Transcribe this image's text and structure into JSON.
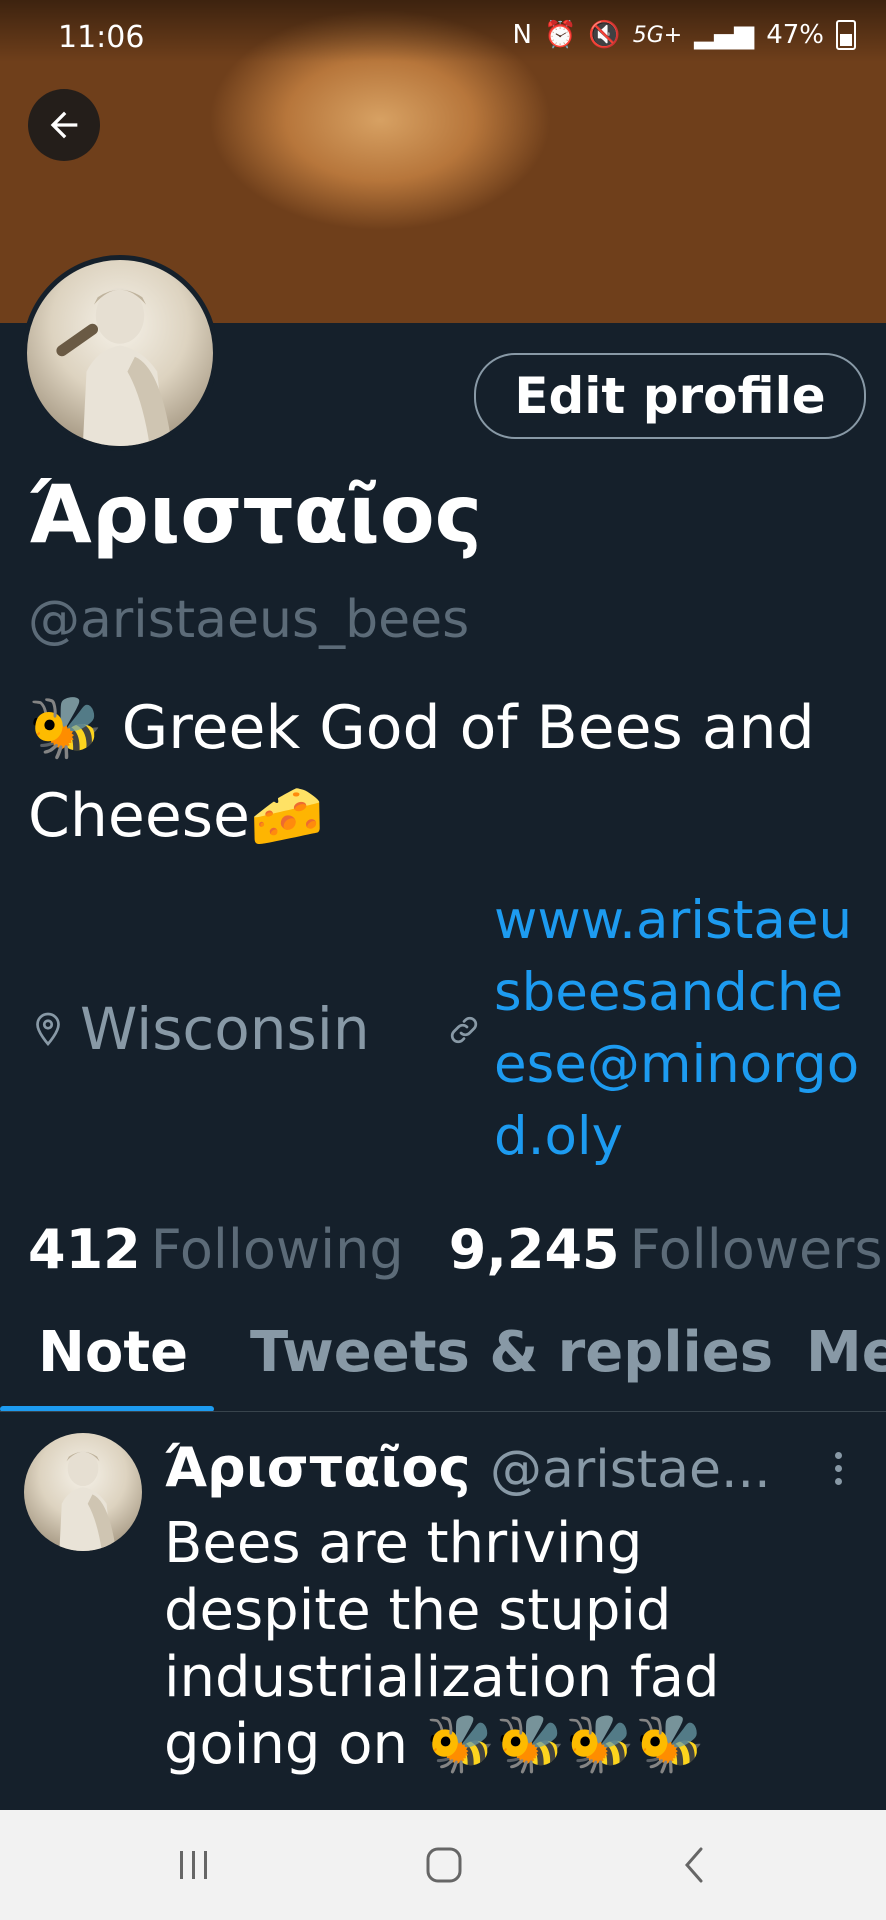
{
  "status_bar": {
    "time": "11:06",
    "network": "5G+",
    "battery": "47%"
  },
  "profile": {
    "edit_label": "Edit profile",
    "name": "Άρισταῖος",
    "handle": "@aristaeus_bees",
    "bio": "🐝 Greek God of Bees and Cheese🧀",
    "location": "Wisconsin",
    "url": "www.aristaeusbeesandcheese@minorgod.oly",
    "following_count": "412",
    "following_label": "Following",
    "followers_count": "9,245",
    "followers_label": "Followers"
  },
  "tabs": [
    {
      "label": "Note",
      "active": true
    },
    {
      "label": "Tweets & replies",
      "active": false
    },
    {
      "label": "Me",
      "active": false
    }
  ],
  "tweet": {
    "name": "Άρισταῖος",
    "handle": "@aristae...",
    "text": "Bees are thriving despite the stupid industrialization fad going on 🐝🐝🐝🐝"
  },
  "icons": {
    "back": "arrow-left-icon",
    "location": "location-pin-icon",
    "link": "link-icon",
    "more": "more-vertical-icon",
    "nav_recents": "recents-icon",
    "nav_home": "home-icon",
    "nav_back": "back-chevron-icon"
  },
  "colors": {
    "background": "#15202b",
    "accent": "#1d9bf0",
    "secondary_text": "#8899a6"
  }
}
